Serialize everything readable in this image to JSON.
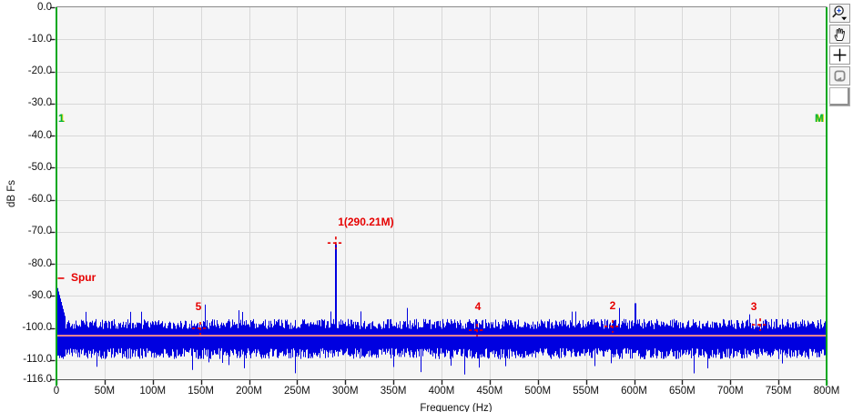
{
  "chart_data": {
    "type": "line",
    "title": "",
    "xlabel": "Frequency (Hz)",
    "ylabel": "dB Fs",
    "x_range_hz": [
      0,
      800000000
    ],
    "y_range_db": [
      -116,
      0
    ],
    "grid": true,
    "x_ticks": [
      "0",
      "50M",
      "100M",
      "150M",
      "200M",
      "250M",
      "300M",
      "350M",
      "400M",
      "450M",
      "500M",
      "550M",
      "600M",
      "650M",
      "700M",
      "750M",
      "800M"
    ],
    "x_tick_mhz": [
      0,
      50,
      100,
      150,
      200,
      250,
      300,
      350,
      400,
      450,
      500,
      550,
      600,
      650,
      700,
      750,
      800
    ],
    "y_ticks": [
      "0.0",
      "-10.0",
      "-20.0",
      "-30.0",
      "-40.0",
      "-50.0",
      "-60.0",
      "-70.0",
      "-80.0",
      "-90.0",
      "-100.0",
      "-110.0",
      "-116.0"
    ],
    "y_tick_db": [
      0,
      -10,
      -20,
      -30,
      -40,
      -50,
      -60,
      -70,
      -80,
      -90,
      -100,
      -110,
      -116
    ],
    "trace_color": "#0000e0",
    "plot_bg": "#f5f5f5",
    "grid_color": "#d8d8d8",
    "noise_floor": {
      "upper_db": -98.5,
      "mean_db": -103.5,
      "lower_db": -108.5
    },
    "average_line": {
      "level_db": -102.4,
      "color": "#ff8c8c"
    },
    "dc_spike": {
      "freq_mhz": 0.9,
      "level_db": -87.5
    },
    "peaks": [
      {
        "freq_mhz": 290.21,
        "level_db": -73.8,
        "width": 2
      },
      {
        "freq_mhz": 154.5,
        "level_db": -92.7,
        "width": 1
      },
      {
        "freq_mhz": 601.5,
        "level_db": -92.3,
        "width": 2
      }
    ],
    "red_markers": [
      {
        "id": "spur",
        "label": "Spur",
        "freq_mhz": 4.7,
        "level_db": -84.5,
        "style": "dash",
        "label_dx": 11,
        "label_dy": -7,
        "align": "left"
      },
      {
        "id": "m5",
        "label": "5",
        "freq_mhz": 149.4,
        "level_db": -100.1,
        "style": "cross",
        "label_dx": -2,
        "label_dy": -30,
        "align": "center"
      },
      {
        "id": "m1",
        "label": "1(290.21M)",
        "freq_mhz": 290.21,
        "level_db": -73.5,
        "style": "cross",
        "label_dx": 33,
        "label_dy": -29,
        "align": "center"
      },
      {
        "id": "m4",
        "label": "4",
        "freq_mhz": 436.9,
        "level_db": -100.7,
        "style": "cross",
        "label_dx": 1,
        "label_dy": -32,
        "align": "center"
      },
      {
        "id": "m2",
        "label": "2",
        "freq_mhz": 577.8,
        "level_db": -99.5,
        "style": "cross",
        "label_dx": 0,
        "label_dy": -29,
        "align": "center"
      },
      {
        "id": "m3",
        "label": "3",
        "freq_mhz": 731.0,
        "level_db": -99.0,
        "style": "cross",
        "label_dx": -7,
        "label_dy": -26,
        "align": "center"
      }
    ],
    "green_cursors": [
      {
        "id": "cursor-1",
        "label": "1",
        "freq_mhz": 0,
        "label_level_db": -35,
        "label_side": "right"
      },
      {
        "id": "cursor-M",
        "label": "M",
        "freq_mhz": 800,
        "label_level_db": -35,
        "label_side": "left"
      }
    ],
    "cursor_color": "#00a820",
    "marker_color": "#e60000"
  },
  "toolbar": {
    "buttons": [
      {
        "id": "zoom-tool",
        "icon": "magnifier-plus-icon",
        "has_dropdown": true
      },
      {
        "id": "pan-tool",
        "icon": "hand-icon"
      },
      {
        "id": "cursor-tool",
        "icon": "plus-crosshair-icon"
      },
      {
        "id": "zoom-reset-tool",
        "icon": "loop-square-icon"
      },
      {
        "id": "blank-tool",
        "icon": "blank"
      }
    ]
  }
}
